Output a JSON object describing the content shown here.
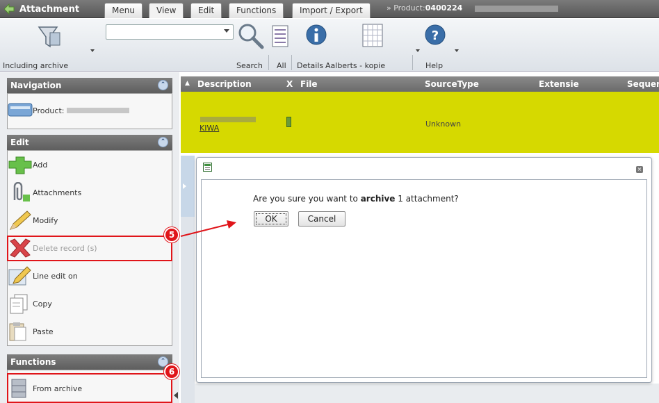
{
  "header": {
    "app_title": "Attachment",
    "tabs": [
      "Menu",
      "View",
      "Edit",
      "Functions",
      "Import / Export"
    ],
    "breadcrumb_prefix": "» Product:",
    "breadcrumb_value": "0400224"
  },
  "toolbar": {
    "archive_label": "Including archive",
    "search_value": "",
    "search_label": "Search",
    "all_label": "All",
    "details_label": "Details",
    "layout_label": "Aalberts - kopie",
    "help_label": "Help"
  },
  "sidebar": {
    "navigation_title": "Navigation",
    "navigation_item": "Product:",
    "edit_title": "Edit",
    "edit_items": [
      "Add",
      "Attachments",
      "Modify",
      "Delete record (s)",
      "Line edit on",
      "Copy",
      "Paste"
    ],
    "functions_title": "Functions",
    "functions_items": [
      "From archive"
    ]
  },
  "grid": {
    "columns": [
      "Description",
      "X",
      "File",
      "SourceType",
      "Extensie",
      "Sequer"
    ],
    "row": {
      "description": "KIWA",
      "source_type": "Unknown"
    }
  },
  "dialog": {
    "message_pre": "Are you sure you want to ",
    "message_bold": "archive",
    "message_post": " 1 attachment?",
    "ok_label": "OK",
    "cancel_label": "Cancel"
  },
  "callouts": {
    "five": "5",
    "six": "6"
  },
  "colors": {
    "selected_row": "#d6d900",
    "callout": "#e0151a",
    "header": "#6a6a6a"
  }
}
